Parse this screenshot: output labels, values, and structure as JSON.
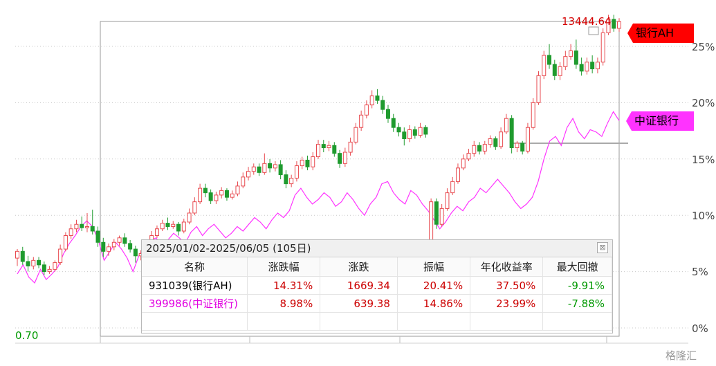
{
  "chart_data": {
    "type": "candlestick-with-line",
    "y_ticks": [
      "25%",
      "20%",
      "15%",
      "10%",
      "5%",
      "0%"
    ],
    "y_tick_values": [
      25,
      20,
      15,
      10,
      5,
      0
    ],
    "ylim": [
      -1,
      28
    ],
    "series": [
      {
        "name": "银行AH",
        "kind": "candle",
        "color_up": "#e8494e",
        "color_down": "#1f9b2e"
      },
      {
        "name": "中证银行",
        "kind": "line",
        "color": "#ff33ff"
      }
    ],
    "peak_label": "13444.64",
    "min_label": "0.70",
    "candles_pct": [
      [
        6.2,
        6.8,
        7.0,
        5.5
      ],
      [
        6.8,
        5.9,
        7.2,
        5.6
      ],
      [
        5.9,
        5.5,
        6.4,
        5.0
      ],
      [
        5.5,
        6.0,
        6.3,
        5.2
      ],
      [
        6.0,
        5.6,
        6.3,
        5.3
      ],
      [
        5.6,
        5.0,
        5.9,
        4.7
      ],
      [
        5.0,
        5.2,
        5.5,
        4.8
      ],
      [
        5.2,
        5.8,
        6.0,
        5.0
      ],
      [
        5.8,
        7.0,
        7.4,
        5.6
      ],
      [
        7.0,
        8.2,
        8.5,
        6.8
      ],
      [
        8.2,
        8.8,
        9.2,
        7.9
      ],
      [
        8.8,
        9.2,
        9.6,
        8.5
      ],
      [
        9.2,
        8.9,
        9.9,
        8.6
      ],
      [
        8.9,
        9.0,
        10.2,
        8.5
      ],
      [
        9.0,
        8.6,
        10.5,
        8.3
      ],
      [
        8.6,
        7.6,
        9.0,
        7.2
      ],
      [
        7.6,
        6.8,
        8.0,
        6.3
      ],
      [
        6.8,
        7.2,
        7.5,
        6.4
      ],
      [
        7.2,
        7.6,
        7.9,
        6.9
      ],
      [
        7.6,
        8.0,
        8.2,
        7.3
      ],
      [
        8.0,
        7.5,
        8.4,
        7.2
      ],
      [
        7.5,
        7.0,
        7.8,
        6.7
      ],
      [
        7.0,
        6.4,
        7.3,
        5.8
      ],
      [
        6.4,
        6.6,
        6.9,
        6.0
      ],
      [
        6.6,
        7.4,
        7.8,
        6.4
      ],
      [
        7.4,
        8.2,
        8.6,
        7.2
      ],
      [
        8.2,
        8.8,
        9.1,
        8.0
      ],
      [
        8.8,
        9.3,
        9.6,
        8.6
      ],
      [
        9.3,
        9.0,
        9.8,
        8.7
      ],
      [
        9.0,
        9.2,
        9.5,
        8.8
      ],
      [
        9.2,
        8.6,
        9.4,
        8.2
      ],
      [
        8.6,
        9.4,
        9.7,
        8.4
      ],
      [
        9.4,
        10.2,
        10.6,
        9.2
      ],
      [
        10.2,
        11.2,
        11.6,
        10.0
      ],
      [
        11.2,
        12.4,
        12.8,
        11.0
      ],
      [
        12.4,
        12.0,
        12.8,
        11.6
      ],
      [
        12.0,
        11.3,
        12.3,
        11.0
      ],
      [
        11.3,
        11.8,
        12.1,
        11.0
      ],
      [
        11.8,
        12.2,
        12.5,
        11.5
      ],
      [
        12.2,
        11.6,
        12.4,
        11.3
      ],
      [
        11.6,
        11.9,
        12.2,
        11.4
      ],
      [
        11.9,
        12.6,
        13.0,
        11.7
      ],
      [
        12.6,
        13.4,
        13.8,
        12.4
      ],
      [
        13.4,
        13.9,
        14.3,
        13.1
      ],
      [
        13.9,
        14.3,
        14.6,
        13.6
      ],
      [
        14.3,
        13.8,
        14.6,
        13.5
      ],
      [
        13.8,
        14.6,
        15.5,
        13.6
      ],
      [
        14.6,
        14.2,
        15.0,
        13.8
      ],
      [
        14.2,
        14.5,
        14.8,
        13.9
      ],
      [
        14.5,
        13.6,
        14.9,
        13.2
      ],
      [
        13.6,
        12.8,
        14.0,
        12.4
      ],
      [
        12.8,
        13.3,
        13.6,
        12.5
      ],
      [
        13.3,
        14.4,
        14.8,
        13.0
      ],
      [
        14.4,
        14.9,
        15.2,
        14.1
      ],
      [
        14.9,
        14.3,
        15.3,
        14.0
      ],
      [
        14.3,
        15.2,
        15.6,
        14.0
      ],
      [
        15.2,
        16.3,
        16.7,
        15.0
      ],
      [
        16.3,
        16.0,
        16.7,
        15.6
      ],
      [
        16.0,
        16.2,
        16.6,
        15.7
      ],
      [
        16.2,
        15.5,
        16.5,
        15.2
      ],
      [
        15.5,
        14.6,
        15.8,
        14.2
      ],
      [
        14.6,
        15.6,
        16.0,
        14.3
      ],
      [
        15.6,
        16.5,
        16.9,
        15.3
      ],
      [
        16.5,
        17.8,
        18.2,
        16.3
      ],
      [
        17.8,
        18.9,
        19.3,
        17.5
      ],
      [
        18.9,
        19.8,
        20.2,
        18.6
      ],
      [
        19.8,
        20.6,
        21.1,
        19.5
      ],
      [
        20.6,
        20.2,
        21.2,
        19.9
      ],
      [
        20.2,
        19.4,
        20.6,
        19.0
      ],
      [
        19.4,
        18.6,
        19.8,
        18.2
      ],
      [
        18.6,
        17.8,
        19.0,
        17.4
      ],
      [
        17.8,
        17.4,
        18.2,
        17.0
      ],
      [
        17.4,
        16.8,
        17.8,
        16.2
      ],
      [
        16.8,
        17.6,
        18.0,
        16.5
      ],
      [
        17.6,
        17.1,
        17.9,
        16.8
      ],
      [
        17.1,
        17.8,
        18.2,
        16.9
      ],
      [
        17.8,
        17.2,
        18.0,
        16.9
      ],
      [
        6.0,
        11.2,
        11.5,
        5.5
      ],
      [
        11.2,
        9.2,
        11.5,
        8.8
      ],
      [
        9.2,
        10.6,
        11.0,
        9.0
      ],
      [
        10.6,
        12.0,
        12.4,
        10.4
      ],
      [
        12.0,
        13.0,
        13.4,
        11.8
      ],
      [
        13.0,
        14.2,
        14.6,
        12.8
      ],
      [
        14.2,
        15.0,
        15.4,
        14.0
      ],
      [
        15.0,
        15.5,
        15.9,
        14.8
      ],
      [
        15.5,
        16.2,
        16.6,
        15.2
      ],
      [
        16.2,
        15.7,
        16.5,
        15.4
      ],
      [
        15.7,
        16.3,
        16.6,
        15.4
      ],
      [
        16.3,
        16.8,
        17.1,
        16.0
      ],
      [
        16.8,
        16.1,
        17.0,
        15.8
      ],
      [
        16.1,
        17.4,
        17.8,
        15.9
      ],
      [
        17.4,
        18.6,
        19.0,
        17.2
      ],
      [
        18.6,
        16.0,
        18.9,
        15.5
      ],
      [
        16.0,
        16.4,
        16.6,
        15.6
      ],
      [
        16.4,
        15.7,
        16.6,
        15.4
      ],
      [
        15.7,
        17.8,
        18.2,
        15.5
      ],
      [
        17.8,
        20.0,
        20.4,
        17.6
      ],
      [
        20.0,
        22.4,
        22.8,
        19.8
      ],
      [
        22.4,
        24.2,
        24.6,
        22.1
      ],
      [
        24.2,
        23.4,
        25.2,
        23.0
      ],
      [
        23.4,
        22.4,
        23.8,
        22.0
      ],
      [
        22.4,
        23.2,
        23.6,
        22.0
      ],
      [
        23.2,
        24.1,
        24.6,
        22.9
      ],
      [
        24.1,
        24.6,
        25.2,
        23.8
      ],
      [
        24.6,
        23.4,
        25.6,
        23.0
      ],
      [
        23.4,
        22.8,
        24.0,
        22.4
      ],
      [
        22.8,
        23.6,
        24.0,
        22.5
      ],
      [
        23.6,
        23.0,
        24.2,
        22.6
      ],
      [
        23.0,
        23.6,
        24.0,
        22.6
      ],
      [
        23.6,
        26.2,
        26.6,
        23.3
      ],
      [
        26.2,
        27.4,
        27.8,
        26.0
      ],
      [
        27.4,
        26.6,
        27.8,
        26.3
      ],
      [
        26.6,
        27.2,
        27.5,
        26.3
      ]
    ],
    "line_pct": [
      4.8,
      5.6,
      4.5,
      4.0,
      5.2,
      4.3,
      4.8,
      5.4,
      6.6,
      7.5,
      8.2,
      9.0,
      9.5,
      9.0,
      7.8,
      6.0,
      6.8,
      7.6,
      7.0,
      6.2,
      5.0,
      6.4,
      7.2,
      7.8,
      8.0,
      7.2,
      7.8,
      8.4,
      8.0,
      7.5,
      8.5,
      9.0,
      8.2,
      8.8,
      9.2,
      8.6,
      8.0,
      8.4,
      9.0,
      8.6,
      9.2,
      9.8,
      9.4,
      8.8,
      9.6,
      10.2,
      9.8,
      10.4,
      11.8,
      12.4,
      11.6,
      11.0,
      11.4,
      12.0,
      11.6,
      10.8,
      11.2,
      12.0,
      11.4,
      10.6,
      10.0,
      11.0,
      11.6,
      12.8,
      13.0,
      12.0,
      11.4,
      11.0,
      12.2,
      11.8,
      11.0,
      10.4,
      9.6,
      8.8,
      9.4,
      10.2,
      10.8,
      10.4,
      11.2,
      11.6,
      12.4,
      12.0,
      12.6,
      13.2,
      12.6,
      12.0,
      11.2,
      10.6,
      11.0,
      11.6,
      13.0,
      15.0,
      16.6,
      17.0,
      16.2,
      17.8,
      18.6,
      17.4,
      16.8,
      17.6,
      17.4,
      17.0,
      18.2,
      19.2,
      18.4
    ]
  },
  "labels": {
    "series_a": "银行AH",
    "series_b": "中证银行"
  },
  "stats": {
    "title": "2025/01/02-2025/06/05 (105日)",
    "close": "⊠",
    "headers": [
      "名称",
      "涨跌幅",
      "涨跌",
      "振幅",
      "年化收益率",
      "最大回撤"
    ],
    "rows": [
      [
        "931039(银行AH)",
        "14.31%",
        "1669.34",
        "20.41%",
        "37.50%",
        "-9.91%"
      ],
      [
        "399986(中证银行)",
        "8.98%",
        "639.38",
        "14.86%",
        "23.99%",
        "-7.88%"
      ]
    ]
  },
  "watermark": "格隆汇",
  "colors": {
    "up": "#e8494e",
    "down": "#1f9b2e",
    "line": "#ff33ff",
    "ah_label": "#ff0000",
    "zz_label": "#ff33ff"
  }
}
